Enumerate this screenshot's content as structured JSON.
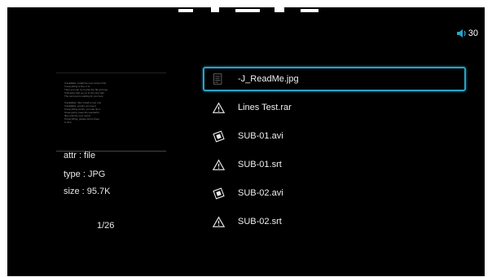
{
  "status": {
    "volume_level": "30",
    "volume_icon": "speaker-icon"
  },
  "preview": {
    "text": "If available, install the new version first\nIf everything is fine, it is\nThen you can try to play the file and see\nIf all goes well, go on to the next part\nThe next part is waiting for you here\n\nIf available, then install a new one\nIf available, ensure you use it\nIf everything works, you can do it\nGreat going, keep the wonderful\nfiles until the next round\nIf everything, please tell us there\nin time"
  },
  "details": {
    "attr_label": "attr : file",
    "type_label": "type : JPG",
    "size_label": "size : 95.7K"
  },
  "pager": {
    "text": "1/26"
  },
  "files": [
    {
      "name": "-J_ReadMe.jpg",
      "icon": "image-file-icon",
      "selected": true
    },
    {
      "name": "Lines Test.rar",
      "icon": "warning-icon",
      "selected": false
    },
    {
      "name": "SUB-01.avi",
      "icon": "film-icon",
      "selected": false
    },
    {
      "name": "SUB-01.srt",
      "icon": "warning-icon",
      "selected": false
    },
    {
      "name": "SUB-02.avi",
      "icon": "film-icon",
      "selected": false
    },
    {
      "name": "SUB-02.srt",
      "icon": "warning-icon",
      "selected": false
    }
  ],
  "colors": {
    "highlight": "#2aa3c8",
    "background": "#000000",
    "text": "#e8e8e8"
  }
}
